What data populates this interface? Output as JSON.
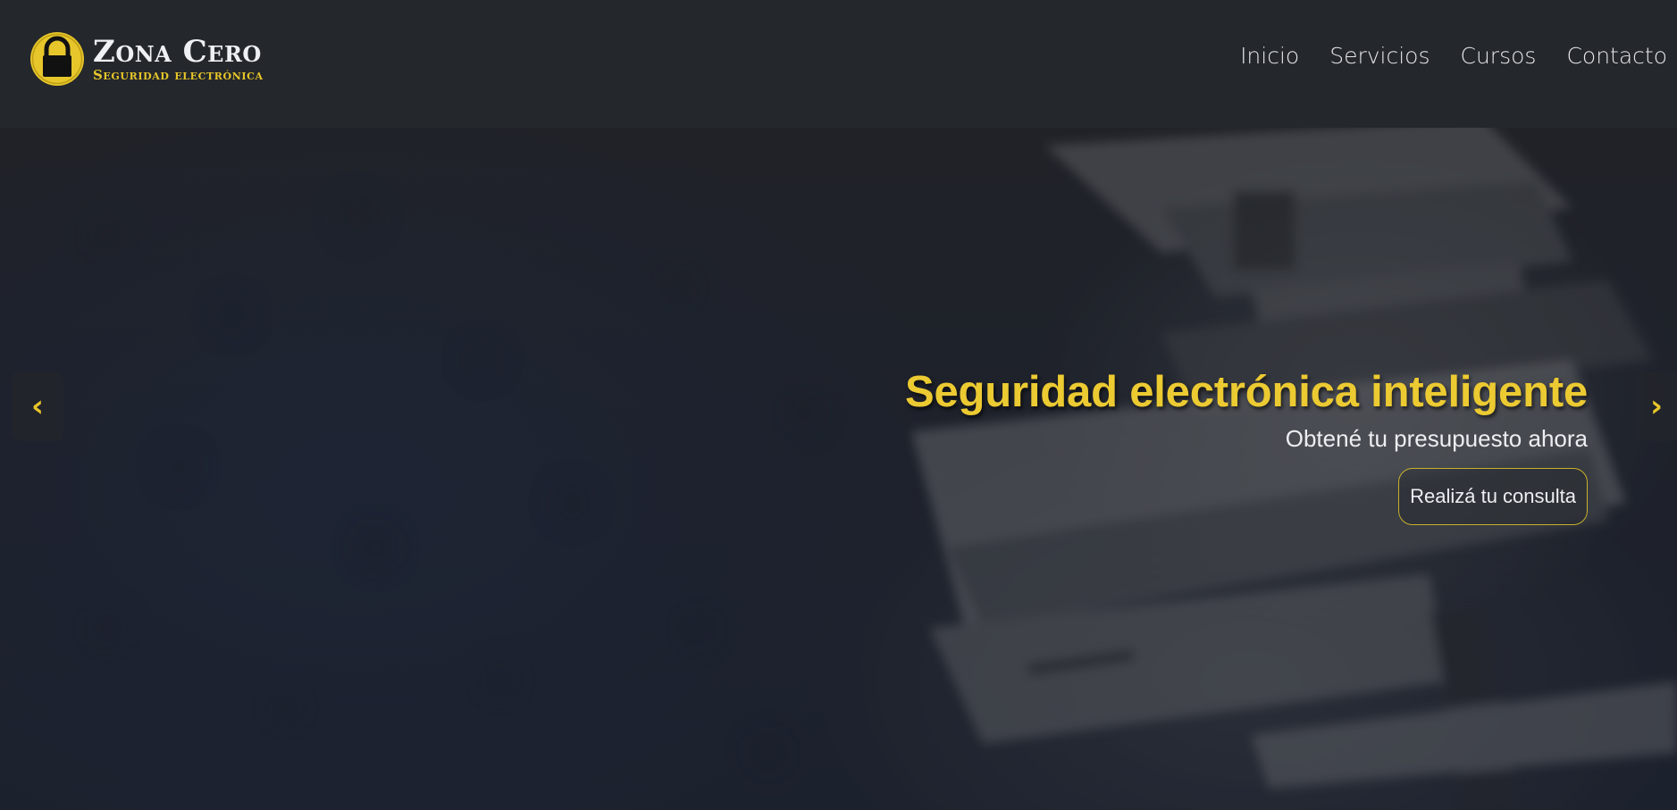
{
  "header": {
    "logo": {
      "title": "Zona Cero",
      "subtitle": "Seguridad electrónica",
      "icon": "padlock-icon",
      "badge_color": "#e7c62b"
    },
    "nav": [
      {
        "label": "Inicio"
      },
      {
        "label": "Servicios"
      },
      {
        "label": "Cursos"
      },
      {
        "label": "Contacto"
      }
    ]
  },
  "hero": {
    "title": "Seguridad electrónica inteligente",
    "subtitle": "Obtené tu presupuesto ahora",
    "cta_label": "Realizá tu consulta",
    "prev_icon": "‹",
    "next_icon": "›",
    "background_image": "security-camera-photo"
  },
  "colors": {
    "accent": "#e7c62b",
    "header_bg": "#24272b",
    "text_light": "#eceef1"
  }
}
